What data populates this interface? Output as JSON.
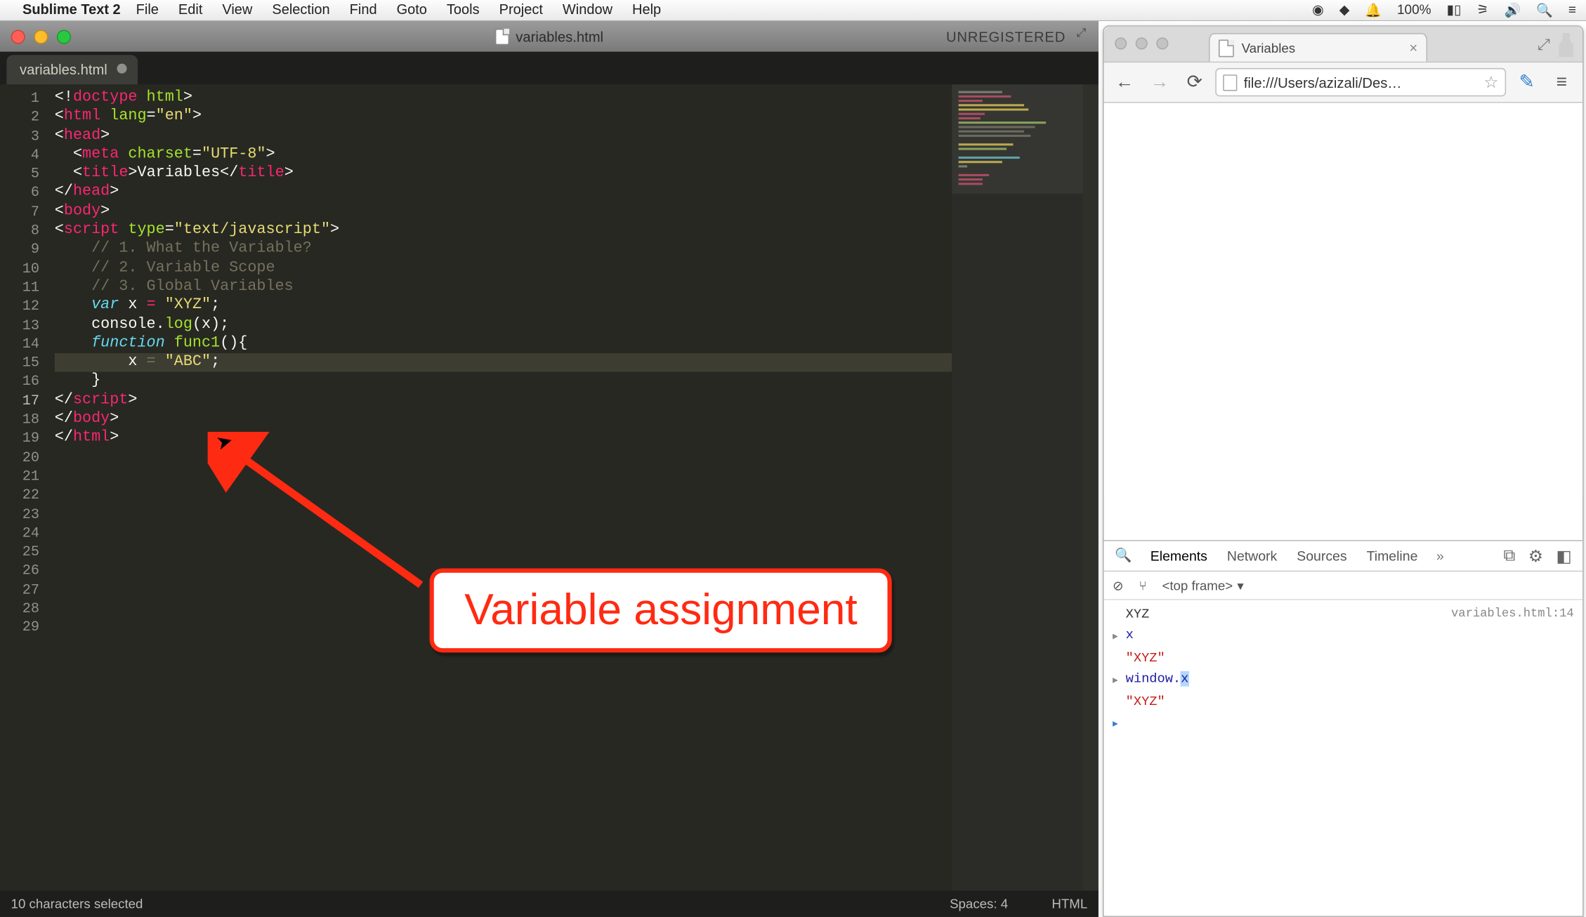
{
  "menubar": {
    "app_name": "Sublime Text 2",
    "items": [
      "File",
      "Edit",
      "View",
      "Selection",
      "Find",
      "Goto",
      "Tools",
      "Project",
      "Window",
      "Help"
    ],
    "battery": "100%"
  },
  "sublime": {
    "window_title": "variables.html",
    "unregistered": "UNREGISTERED",
    "tab_title": "variables.html",
    "status": {
      "selection": "10 characters selected",
      "spaces": "Spaces: 4",
      "syntax": "HTML"
    },
    "line_count": 29,
    "highlight_line": 17,
    "code_lines": [
      [
        [
          "punct",
          "<!"
        ],
        [
          "tag",
          "doctype"
        ],
        [
          "punct",
          " "
        ],
        [
          "attr",
          "html"
        ],
        [
          "punct",
          ">"
        ]
      ],
      [
        [
          "punct",
          "<"
        ],
        [
          "tag",
          "html"
        ],
        [
          "punct",
          " "
        ],
        [
          "attr",
          "lang"
        ],
        [
          "punct",
          "="
        ],
        [
          "str",
          "\"en\""
        ],
        [
          "punct",
          ">"
        ]
      ],
      [
        [
          "punct",
          "<"
        ],
        [
          "tag",
          "head"
        ],
        [
          "punct",
          ">"
        ]
      ],
      [
        [
          "punct",
          "  <"
        ],
        [
          "tag",
          "meta"
        ],
        [
          "punct",
          " "
        ],
        [
          "attr",
          "charset"
        ],
        [
          "punct",
          "="
        ],
        [
          "str",
          "\"UTF-8\""
        ],
        [
          "punct",
          ">"
        ]
      ],
      [
        [
          "punct",
          "  <"
        ],
        [
          "tag",
          "title"
        ],
        [
          "punct",
          ">"
        ],
        [
          "var",
          "Variables"
        ],
        [
          "punct",
          "</"
        ],
        [
          "tag",
          "title"
        ],
        [
          "punct",
          ">"
        ]
      ],
      [
        [
          "punct",
          "</"
        ],
        [
          "tag",
          "head"
        ],
        [
          "punct",
          ">"
        ]
      ],
      [
        [
          "punct",
          "<"
        ],
        [
          "tag",
          "body"
        ],
        [
          "punct",
          ">"
        ]
      ],
      [
        [
          "punct",
          "<"
        ],
        [
          "tag",
          "script"
        ],
        [
          "punct",
          " "
        ],
        [
          "attr",
          "type"
        ],
        [
          "punct",
          "="
        ],
        [
          "str",
          "\"text/javascript\""
        ],
        [
          "punct",
          ">"
        ]
      ],
      [
        [
          "com",
          "    // 1. What the Variable?"
        ]
      ],
      [
        [
          "com",
          "    // 2. Variable Scope"
        ]
      ],
      [
        [
          "com",
          "    // 3. Global Variables"
        ]
      ],
      [
        [
          "punct",
          ""
        ]
      ],
      [
        [
          "punct",
          "    "
        ],
        [
          "kw",
          "var"
        ],
        [
          "punct",
          " "
        ],
        [
          "var",
          "x"
        ],
        [
          "punct",
          " "
        ],
        [
          "kw2",
          "="
        ],
        [
          "punct",
          " "
        ],
        [
          "str",
          "\"XYZ\""
        ],
        [
          "punct",
          ";"
        ]
      ],
      [
        [
          "punct",
          "    "
        ],
        [
          "var",
          "console"
        ],
        [
          "punct",
          "."
        ],
        [
          "fn",
          "log"
        ],
        [
          "punct",
          "("
        ],
        [
          "var",
          "x"
        ],
        [
          "punct",
          ");"
        ]
      ],
      [
        [
          "punct",
          ""
        ]
      ],
      [
        [
          "punct",
          "    "
        ],
        [
          "kw",
          "function"
        ],
        [
          "punct",
          " "
        ],
        [
          "fn",
          "func1"
        ],
        [
          "punct",
          "(){"
        ]
      ],
      [
        [
          "punct",
          "        "
        ],
        [
          "var",
          "x"
        ],
        [
          "dim",
          " = "
        ],
        [
          "str",
          "\"ABC\""
        ],
        [
          "punct",
          ";"
        ]
      ],
      [
        [
          "punct",
          "    }"
        ]
      ],
      [
        [
          "punct",
          ""
        ]
      ],
      [
        [
          "punct",
          ""
        ]
      ],
      [
        [
          "punct",
          "</"
        ],
        [
          "tag",
          "script"
        ],
        [
          "punct",
          ">"
        ]
      ],
      [
        [
          "punct",
          "</"
        ],
        [
          "tag",
          "body"
        ],
        [
          "punct",
          ">"
        ]
      ],
      [
        [
          "punct",
          "</"
        ],
        [
          "tag",
          "html"
        ],
        [
          "punct",
          ">"
        ]
      ],
      [
        [
          "punct",
          ""
        ]
      ],
      [
        [
          "punct",
          ""
        ]
      ],
      [
        [
          "punct",
          ""
        ]
      ],
      [
        [
          "punct",
          ""
        ]
      ],
      [
        [
          "punct",
          ""
        ]
      ],
      [
        [
          "punct",
          ""
        ]
      ]
    ]
  },
  "chrome": {
    "tab_title": "Variables",
    "address": "file:///Users/azizali/Des…",
    "devtools": {
      "tabs": [
        "Elements",
        "Network",
        "Sources",
        "Timeline"
      ],
      "active_tab": "Elements",
      "frame_label": "<top frame>",
      "search_icon": "🔍",
      "console": {
        "log_value": "XYZ",
        "log_source": "variables.html:14",
        "entries": [
          {
            "input": "x",
            "output": "\"XYZ\""
          },
          {
            "input_pre": "window.",
            "input_hl": "x",
            "output": "\"XYZ\""
          }
        ]
      }
    }
  },
  "annotation": {
    "text": "Variable assignment"
  }
}
